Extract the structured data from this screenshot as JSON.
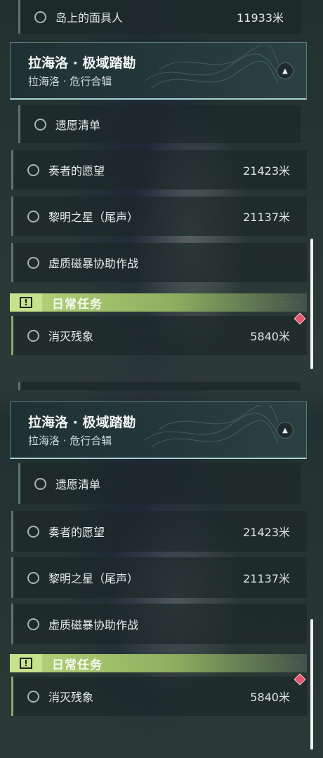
{
  "panels": [
    {
      "top_task": {
        "label": "岛上的面具人",
        "distance": "11933米"
      },
      "section": {
        "title": "拉海洛 · 极域踏勘",
        "subtitle": "拉海洛 · 危行合辑",
        "tasks": [
          {
            "label": "遗愿清单",
            "distance": ""
          },
          {
            "label": "奏者的愿望",
            "distance": "21423米"
          },
          {
            "label": "黎明之星（尾声）",
            "distance": "21137米"
          },
          {
            "label": "虚质磁暴协助作战",
            "distance": ""
          }
        ]
      },
      "daily": {
        "label": "日常任务",
        "icon": "!",
        "tasks": [
          {
            "label": "消灭残象",
            "distance": "5840米"
          }
        ]
      }
    },
    {
      "section": {
        "title": "拉海洛 · 极域踏勘",
        "subtitle": "拉海洛 · 危行合辑",
        "tasks": [
          {
            "label": "遗愿清单",
            "distance": ""
          },
          {
            "label": "奏者的愿望",
            "distance": "21423米"
          },
          {
            "label": "黎明之星（尾声）",
            "distance": "21137米"
          },
          {
            "label": "虚质磁暴协助作战",
            "distance": ""
          }
        ]
      },
      "daily": {
        "label": "日常任务",
        "icon": "!",
        "tasks": [
          {
            "label": "消灭残象",
            "distance": "5840米"
          }
        ]
      }
    }
  ],
  "colors": {
    "daily_accent": "#b9d77c",
    "tracked_marker": "#e0566a"
  },
  "icons": {
    "collapse": "chevron-up-icon",
    "daily": "exclamation-icon",
    "marker": "diamond-marker-icon"
  }
}
